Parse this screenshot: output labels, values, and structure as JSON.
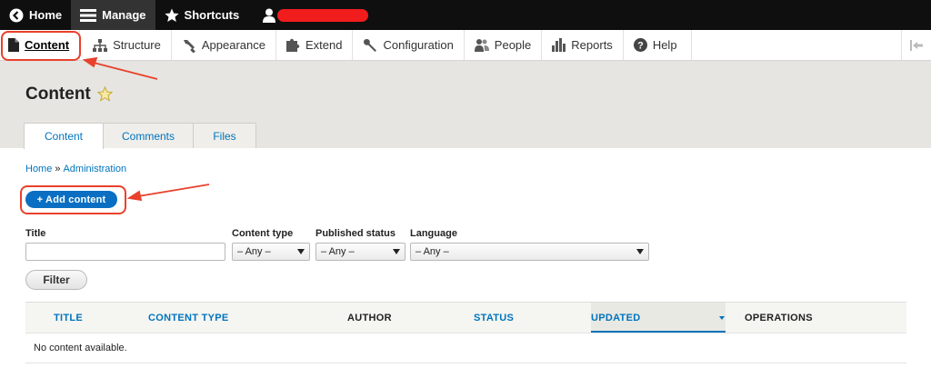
{
  "toolbar": {
    "home": "Home",
    "manage": "Manage",
    "shortcuts": "Shortcuts"
  },
  "tray": {
    "items": [
      {
        "label": "Content",
        "icon": "file-icon"
      },
      {
        "label": "Structure",
        "icon": "sitemap-icon"
      },
      {
        "label": "Appearance",
        "icon": "wrench-brush-icon"
      },
      {
        "label": "Extend",
        "icon": "puzzle-icon"
      },
      {
        "label": "Configuration",
        "icon": "wrench-icon"
      },
      {
        "label": "People",
        "icon": "people-icon"
      },
      {
        "label": "Reports",
        "icon": "bar-chart-icon"
      },
      {
        "label": "Help",
        "icon": "help-icon"
      }
    ]
  },
  "page": {
    "title": "Content",
    "tabs": [
      "Content",
      "Comments",
      "Files"
    ]
  },
  "breadcrumb": {
    "home": "Home",
    "separator": "»",
    "admin": "Administration"
  },
  "actions": {
    "add_content": "+ Add content"
  },
  "filters": {
    "title_label": "Title",
    "title_value": "",
    "type_label": "Content type",
    "type_value": "– Any –",
    "status_label": "Published status",
    "status_value": "– Any –",
    "language_label": "Language",
    "language_value": "– Any –",
    "filter_button": "Filter"
  },
  "table": {
    "columns": [
      "TITLE",
      "CONTENT TYPE",
      "AUTHOR",
      "STATUS",
      "UPDATED",
      "OPERATIONS"
    ],
    "empty": "No content available."
  },
  "colors": {
    "link": "#0074bd",
    "annotation": "#e8412c",
    "primary_button": "#0a6fc2"
  }
}
